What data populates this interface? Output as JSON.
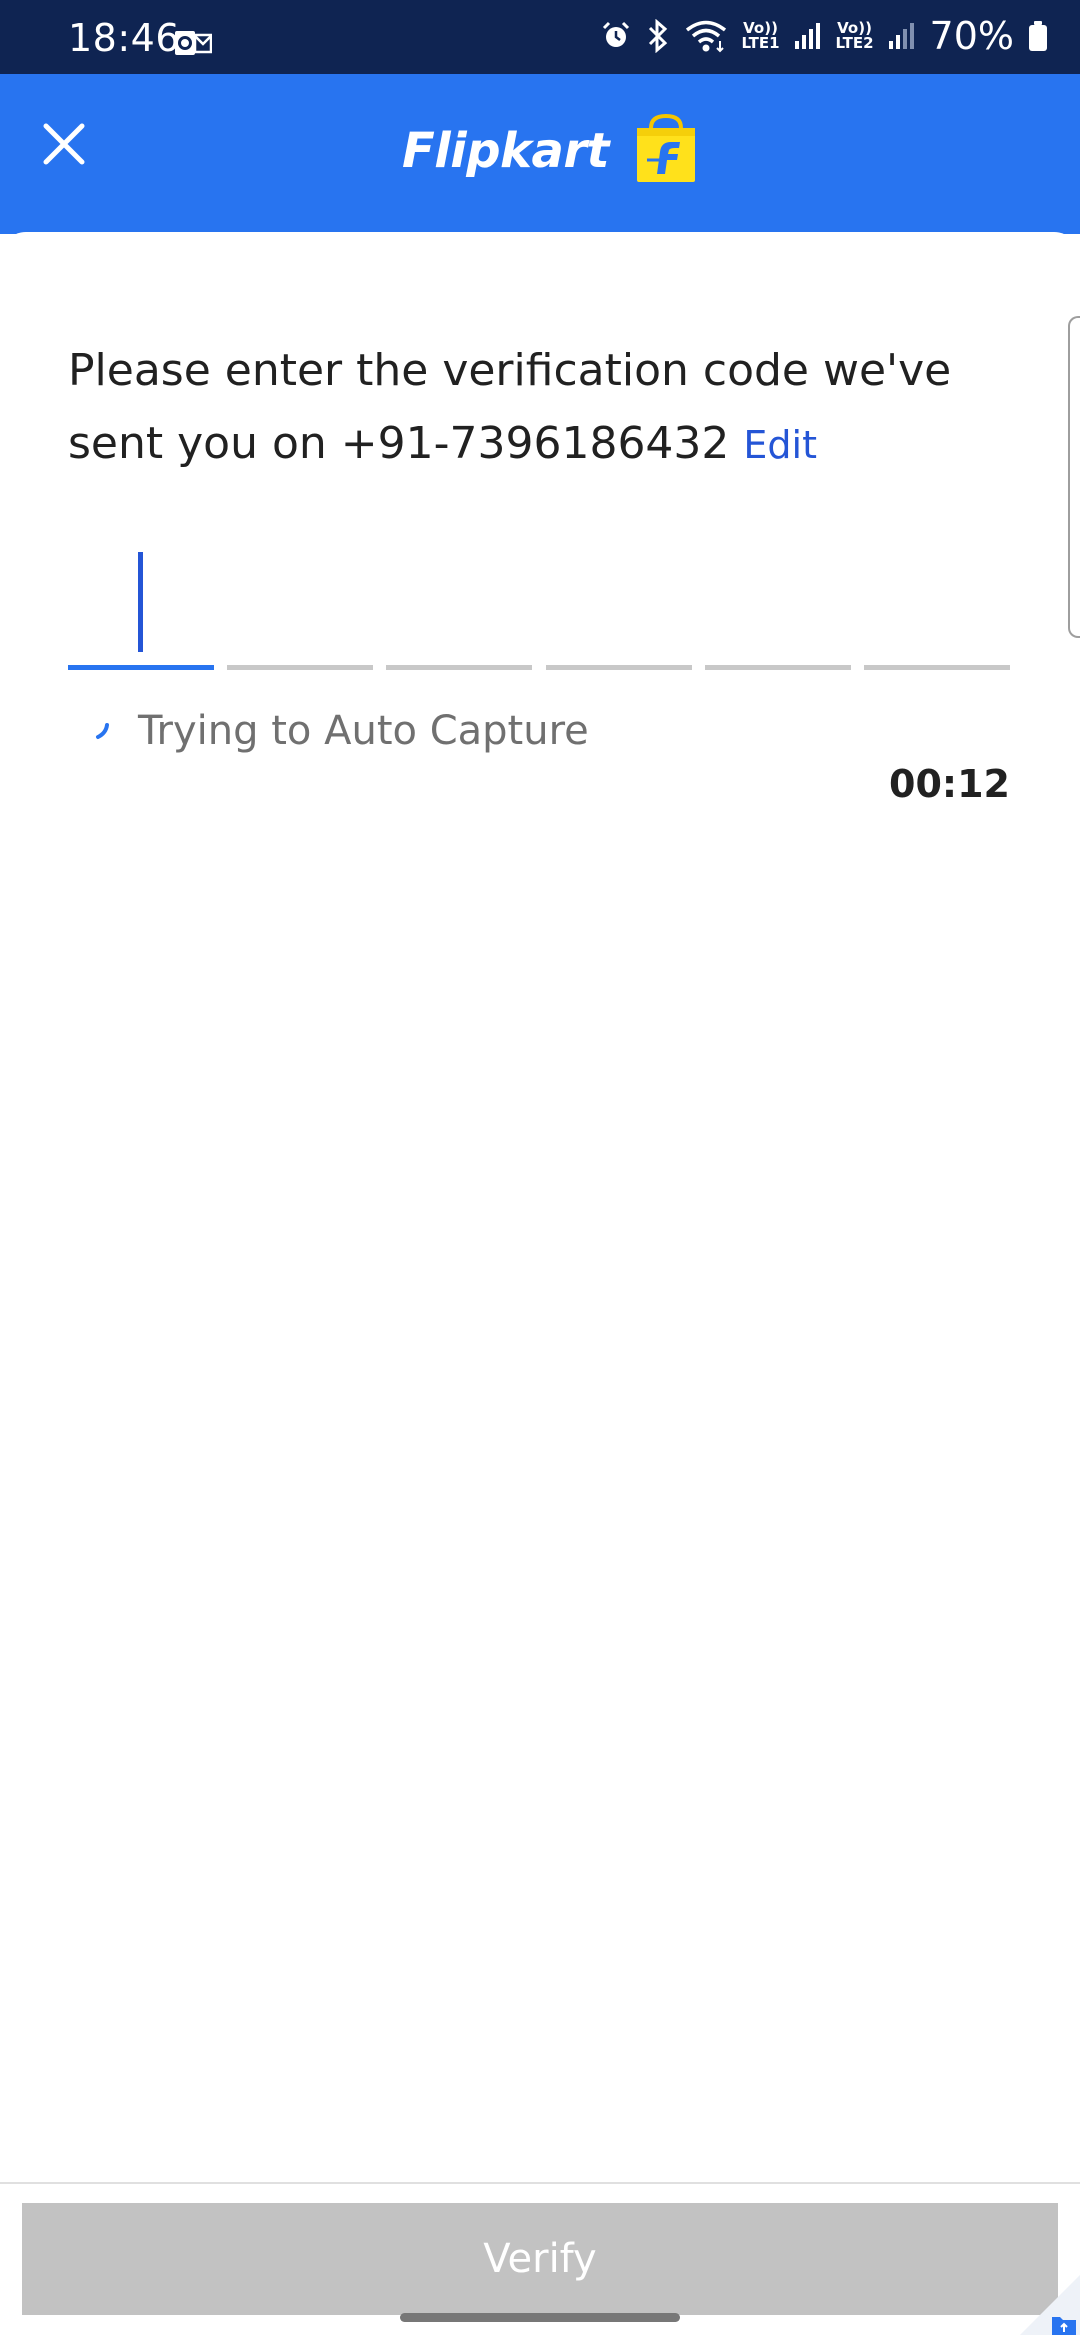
{
  "status_bar": {
    "time": "18:46",
    "battery_percent": "70%",
    "sim1_label": "Vo))\nLTE1",
    "sim1_top": "Vo))",
    "sim1_bottom": "LTE1",
    "sim2_top": "Vo))",
    "sim2_bottom": "LTE2",
    "icons": [
      "outlook-notification-icon",
      "alarm-icon",
      "bluetooth-icon",
      "wifi-icon",
      "signal-icon",
      "battery-icon"
    ]
  },
  "header": {
    "brand": "Flipkart",
    "close_icon": "close-icon",
    "logo_icon": "flipkart-bag-icon",
    "background_color": "#2874f0"
  },
  "otp_screen": {
    "message": "Please enter the verification code we've sent you on +91-7396186432",
    "edit_label": "Edit",
    "code_length": 6,
    "filled_digits": [
      "",
      "",
      "",
      "",
      "",
      ""
    ],
    "active_index": 0,
    "auto_capture_text": "Trying to Auto Capture",
    "timer": "00:12"
  },
  "footer": {
    "verify_label": "Verify",
    "verify_enabled": false
  },
  "colors": {
    "accent": "#2874f0",
    "link": "#2455d6",
    "disabled_button": "#c2c2c2",
    "status_bar": "#0f2452"
  }
}
